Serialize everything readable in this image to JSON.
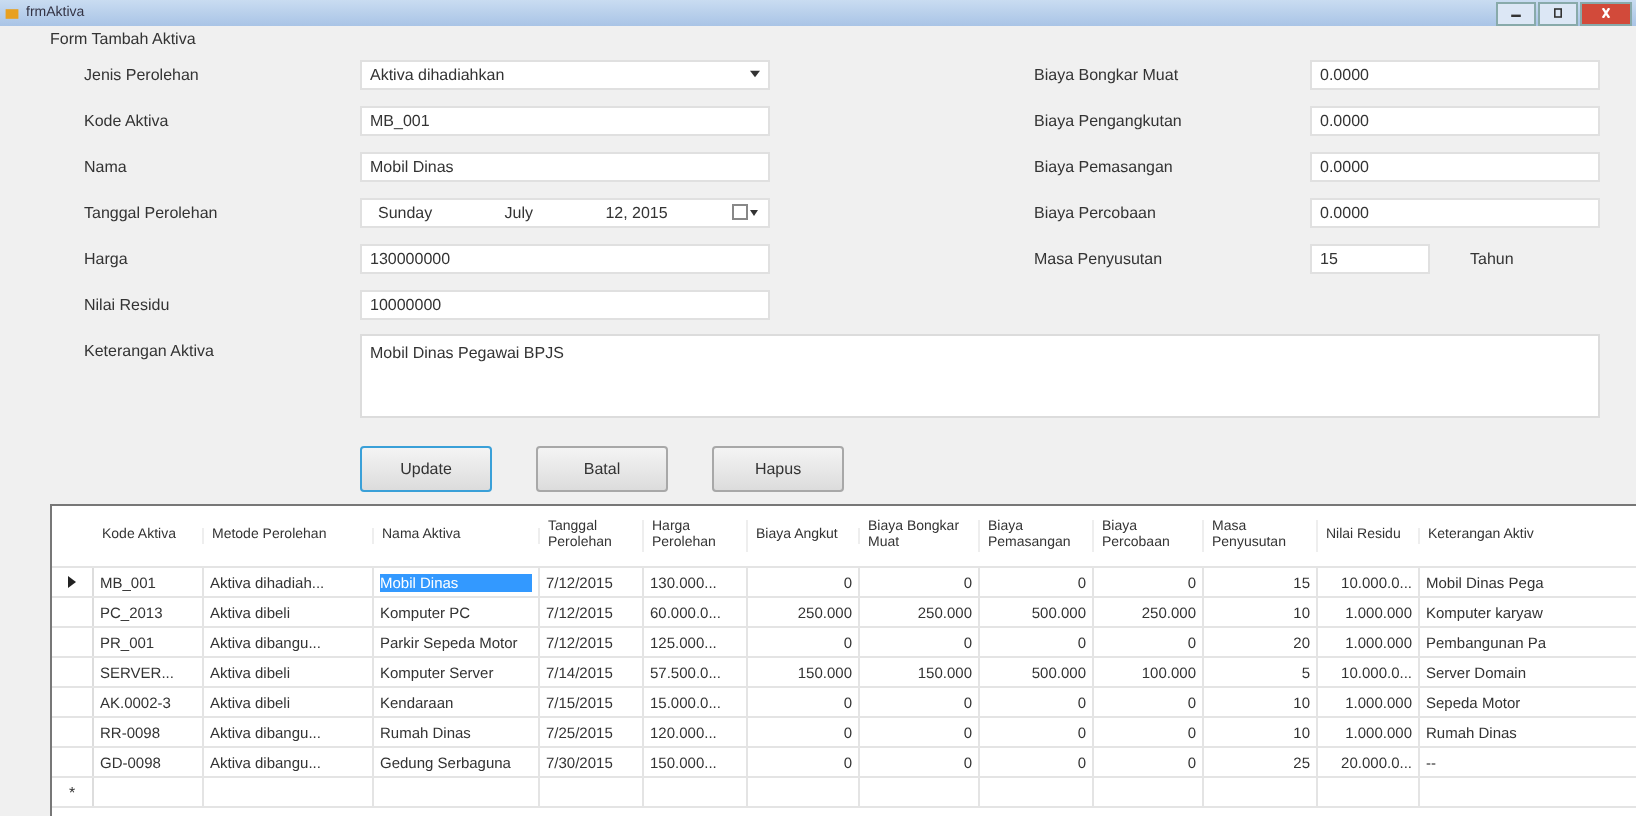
{
  "window": {
    "title": "frmAktiva"
  },
  "group_title": "Form Tambah Aktiva",
  "left_fields": [
    {
      "label": "Jenis Perolehan",
      "kind": "dropdown",
      "value": "Aktiva dihadiahkan"
    },
    {
      "label": "Kode Aktiva",
      "kind": "text",
      "value": "MB_001"
    },
    {
      "label": "Nama",
      "kind": "text",
      "value": "Mobil Dinas"
    },
    {
      "label": "Tanggal Perolehan",
      "kind": "date",
      "parts": [
        "Sunday",
        "July",
        "12, 2015"
      ]
    },
    {
      "label": "Harga",
      "kind": "text",
      "value": "130000000"
    },
    {
      "label": "Nilai Residu",
      "kind": "text",
      "value": "10000000"
    }
  ],
  "right_fields": [
    {
      "label": "Biaya Bongkar Muat",
      "value": "0.0000"
    },
    {
      "label": "Biaya Pengangkutan",
      "value": "0.0000"
    },
    {
      "label": "Biaya Pemasangan",
      "value": "0.0000"
    },
    {
      "label": "Biaya Percobaan",
      "value": "0.0000"
    },
    {
      "label": "Masa Penyusutan",
      "value": "15",
      "unit": "Tahun"
    }
  ],
  "notes": {
    "label": "Keterangan Aktiva",
    "value": "Mobil Dinas Pegawai BPJS"
  },
  "buttons": [
    {
      "label": "Update",
      "focused": true
    },
    {
      "label": "Batal",
      "focused": false
    },
    {
      "label": "Hapus",
      "focused": false
    }
  ],
  "table": {
    "columns": [
      {
        "label": "Kode Aktiva",
        "kind": "text"
      },
      {
        "label": "Metode Perolehan",
        "kind": "text"
      },
      {
        "label": "Nama Aktiva",
        "kind": "text"
      },
      {
        "label": "Tanggal Perolehan",
        "kind": "text"
      },
      {
        "label": "Harga Perolehan",
        "kind": "text"
      },
      {
        "label": "Biaya Angkut",
        "kind": "number"
      },
      {
        "label": "Biaya Bongkar Muat",
        "kind": "number"
      },
      {
        "label": "Biaya Pemasangan",
        "kind": "number"
      },
      {
        "label": "Biaya Percobaan",
        "kind": "number"
      },
      {
        "label": "Masa Penyusutan",
        "kind": "number"
      },
      {
        "label": "Nilai Residu",
        "kind": "number"
      },
      {
        "label": "Keterangan Aktiv",
        "kind": "text"
      }
    ],
    "rows": [
      {
        "current": true,
        "cells": [
          {
            "text": "MB_001",
            "selected": false
          },
          {
            "text": "Aktiva dihadiah...",
            "selected": false
          },
          {
            "text": "Mobil Dinas",
            "selected": true
          },
          {
            "text": "7/12/2015",
            "selected": false
          },
          {
            "text": "130.000...",
            "selected": false
          },
          {
            "text": "0",
            "selected": false
          },
          {
            "text": "0",
            "selected": false
          },
          {
            "text": "0",
            "selected": false
          },
          {
            "text": "0",
            "selected": false
          },
          {
            "text": "15",
            "selected": false
          },
          {
            "text": "10.000.0...",
            "selected": false
          },
          {
            "text": "Mobil Dinas Pega",
            "selected": false
          }
        ]
      },
      {
        "current": false,
        "cells": [
          {
            "text": "PC_2013",
            "selected": false
          },
          {
            "text": "Aktiva dibeli",
            "selected": false
          },
          {
            "text": "Komputer PC",
            "selected": false
          },
          {
            "text": "7/12/2015",
            "selected": false
          },
          {
            "text": "60.000.0...",
            "selected": false
          },
          {
            "text": "250.000",
            "selected": false
          },
          {
            "text": "250.000",
            "selected": false
          },
          {
            "text": "500.000",
            "selected": false
          },
          {
            "text": "250.000",
            "selected": false
          },
          {
            "text": "10",
            "selected": false
          },
          {
            "text": "1.000.000",
            "selected": false
          },
          {
            "text": "Komputer karyaw",
            "selected": false
          }
        ]
      },
      {
        "current": false,
        "cells": [
          {
            "text": "PR_001",
            "selected": false
          },
          {
            "text": "Aktiva dibangu...",
            "selected": false
          },
          {
            "text": "Parkir Sepeda Motor",
            "selected": false
          },
          {
            "text": "7/12/2015",
            "selected": false
          },
          {
            "text": "125.000...",
            "selected": false
          },
          {
            "text": "0",
            "selected": false
          },
          {
            "text": "0",
            "selected": false
          },
          {
            "text": "0",
            "selected": false
          },
          {
            "text": "0",
            "selected": false
          },
          {
            "text": "20",
            "selected": false
          },
          {
            "text": "1.000.000",
            "selected": false
          },
          {
            "text": "Pembangunan Pa",
            "selected": false
          }
        ]
      },
      {
        "current": false,
        "cells": [
          {
            "text": "SERVER...",
            "selected": false
          },
          {
            "text": "Aktiva dibeli",
            "selected": false
          },
          {
            "text": "Komputer Server",
            "selected": false
          },
          {
            "text": "7/14/2015",
            "selected": false
          },
          {
            "text": "57.500.0...",
            "selected": false
          },
          {
            "text": "150.000",
            "selected": false
          },
          {
            "text": "150.000",
            "selected": false
          },
          {
            "text": "500.000",
            "selected": false
          },
          {
            "text": "100.000",
            "selected": false
          },
          {
            "text": "5",
            "selected": false
          },
          {
            "text": "10.000.0...",
            "selected": false
          },
          {
            "text": "Server Domain",
            "selected": false
          }
        ]
      },
      {
        "current": false,
        "cells": [
          {
            "text": "AK.0002-3",
            "selected": false
          },
          {
            "text": "Aktiva dibeli",
            "selected": false
          },
          {
            "text": "Kendaraan",
            "selected": false
          },
          {
            "text": "7/15/2015",
            "selected": false
          },
          {
            "text": "15.000.0...",
            "selected": false
          },
          {
            "text": "0",
            "selected": false
          },
          {
            "text": "0",
            "selected": false
          },
          {
            "text": "0",
            "selected": false
          },
          {
            "text": "0",
            "selected": false
          },
          {
            "text": "10",
            "selected": false
          },
          {
            "text": "1.000.000",
            "selected": false
          },
          {
            "text": "Sepeda Motor",
            "selected": false
          }
        ]
      },
      {
        "current": false,
        "cells": [
          {
            "text": "RR-0098",
            "selected": false
          },
          {
            "text": "Aktiva dibangu...",
            "selected": false
          },
          {
            "text": "Rumah Dinas",
            "selected": false
          },
          {
            "text": "7/25/2015",
            "selected": false
          },
          {
            "text": "120.000...",
            "selected": false
          },
          {
            "text": "0",
            "selected": false
          },
          {
            "text": "0",
            "selected": false
          },
          {
            "text": "0",
            "selected": false
          },
          {
            "text": "0",
            "selected": false
          },
          {
            "text": "10",
            "selected": false
          },
          {
            "text": "1.000.000",
            "selected": false
          },
          {
            "text": "Rumah Dinas",
            "selected": false
          }
        ]
      },
      {
        "current": false,
        "cells": [
          {
            "text": "GD-0098",
            "selected": false
          },
          {
            "text": "Aktiva dibangu...",
            "selected": false
          },
          {
            "text": "Gedung Serbaguna",
            "selected": false
          },
          {
            "text": "7/30/2015",
            "selected": false
          },
          {
            "text": "150.000...",
            "selected": false
          },
          {
            "text": "0",
            "selected": false
          },
          {
            "text": "0",
            "selected": false
          },
          {
            "text": "0",
            "selected": false
          },
          {
            "text": "0",
            "selected": false
          },
          {
            "text": "25",
            "selected": false
          },
          {
            "text": "20.000.0...",
            "selected": false
          },
          {
            "text": "--",
            "selected": false
          }
        ]
      }
    ],
    "new_row": {
      "marker": "*"
    }
  }
}
